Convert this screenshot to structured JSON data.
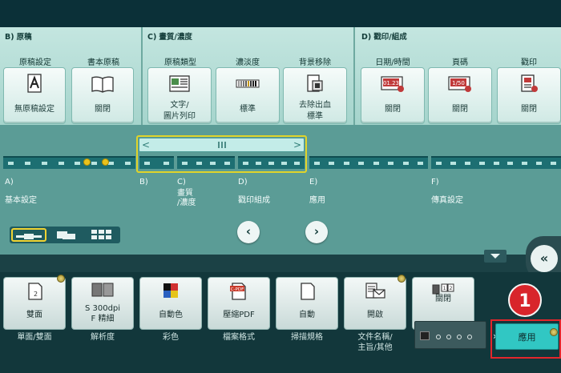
{
  "groups": [
    {
      "letter": "B)",
      "title": "原稿"
    },
    {
      "letter": "C)",
      "title": "畫質/濃度"
    },
    {
      "letter": "D)",
      "title": "戳印/組成"
    }
  ],
  "upper_tiles": [
    {
      "label": "原稿設定",
      "value": "無原稿設定",
      "icon": "document-a-icon"
    },
    {
      "label": "書本原稿",
      "value": "關閉",
      "icon": "open-book-icon"
    },
    {
      "label": "原稿類型",
      "value": "文字/\n圖片列印",
      "icon": "text-photo-icon"
    },
    {
      "label": "濃淡度",
      "value": "標準",
      "icon": "density-scale-icon"
    },
    {
      "label": "背景移除",
      "value": "去除出血\n標準",
      "icon": "background-removal-icon"
    },
    {
      "label": "日期/時間",
      "value": "關閉",
      "icon": "date-stamp-icon"
    },
    {
      "label": "頁碼",
      "value": "關閉",
      "icon": "page-number-icon"
    },
    {
      "label": "戳印",
      "value": "關閉",
      "icon": "stamp-icon"
    }
  ],
  "navigator": {
    "sections": [
      {
        "letter": "A)",
        "name": "基本設定"
      },
      {
        "letter": "B)",
        "name": ""
      },
      {
        "letter": "C)",
        "name": "畫質\n/濃度"
      },
      {
        "letter": "D)",
        "name": "戳印組成"
      },
      {
        "letter": "E)",
        "name": "應用"
      },
      {
        "letter": "F)",
        "name": "傳真設定"
      }
    ],
    "prev_label": "‹",
    "next_label": "›"
  },
  "lower_tiles": [
    {
      "value": "雙面",
      "caption": "單面/雙面",
      "icon": "duplex-icon",
      "has_dot": true
    },
    {
      "value": "S 300dpi\nF 精細",
      "caption": "解析度",
      "icon": "resolution-icon",
      "has_dot": false
    },
    {
      "value": "自動色",
      "caption": "彩色",
      "icon": "auto-color-icon",
      "has_dot": false
    },
    {
      "value": "壓縮PDF",
      "caption": "檔案格式",
      "icon": "pdf-file-icon",
      "has_dot": false
    },
    {
      "value": "自動",
      "caption": "掃描規格",
      "icon": "scan-size-icon",
      "has_dot": false
    },
    {
      "value": "開啟",
      "caption": "文件名稱/\n主旨/其他",
      "icon": "document-mail-icon",
      "has_dot": true
    },
    {
      "value": "關閉",
      "caption": "",
      "icon": "separate-scan-icon",
      "has_dot": false
    }
  ],
  "apply_button": {
    "label": "應用"
  },
  "annotation": {
    "number": "1"
  },
  "colors": {
    "accent": "#31c7c3",
    "highlight": "#e0d42a",
    "annotation_red": "#d8252b"
  }
}
